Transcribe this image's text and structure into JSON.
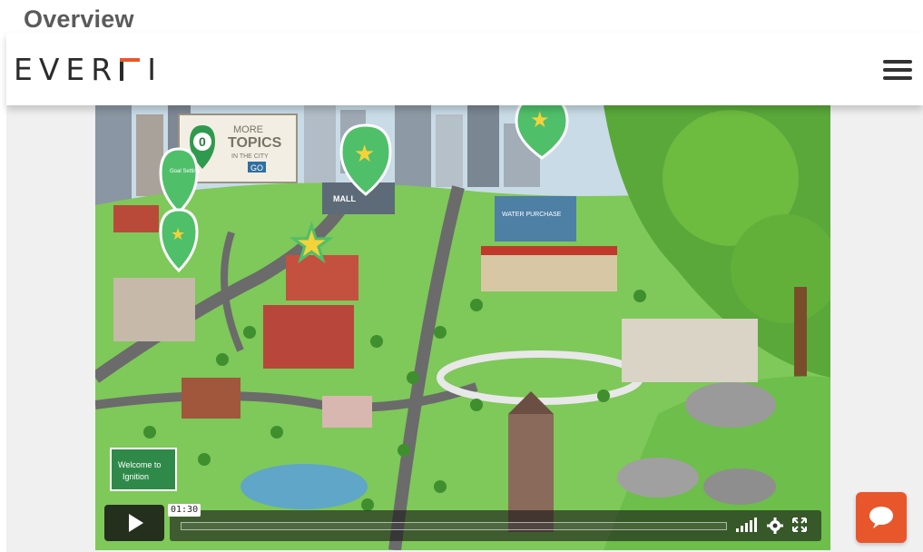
{
  "page": {
    "heading": "Overview"
  },
  "header": {
    "logo_text": "EVER",
    "logo_tail": "I",
    "menu_icon": "hamburger-menu-icon"
  },
  "video": {
    "map_sign": {
      "count": "0",
      "line1": "MORE",
      "line2": "TOPICS",
      "line3": "IN THE CITY",
      "button": "GO"
    },
    "mall_label": "MALL",
    "store_sign": "WATER PURCHASE",
    "pin_label": "Goal Setting",
    "welcome_sign": {
      "line1": "Welcome to",
      "line2": "Ignition"
    },
    "player": {
      "time_tooltip": "01:30",
      "progress_fraction": 0.0,
      "icons": {
        "play": "play-icon",
        "volume": "volume-icon",
        "settings": "gear-icon",
        "fullscreen": "fullscreen-icon"
      }
    }
  },
  "chat": {
    "icon": "chat-bubble-icon"
  },
  "colors": {
    "accent": "#e8572b",
    "grass": "#7fc85a",
    "pin": "#4fbf6a"
  }
}
